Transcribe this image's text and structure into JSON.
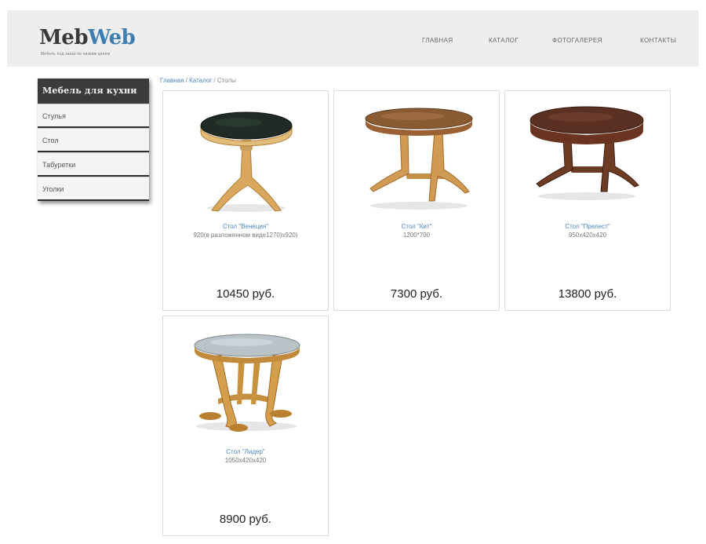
{
  "header": {
    "logo_part1": "Meb",
    "logo_part2": "Web",
    "tagline": "Мебель под заказ по низким ценам",
    "nav": [
      "ГЛАВНАЯ",
      "КАТАЛОГ",
      "ФОТОГАЛЕРЕЯ",
      "КОНТАКТЫ"
    ]
  },
  "sidebar": {
    "title": "Мебель для кухни",
    "items": [
      "Стулья",
      "Стол",
      "Табуретки",
      "Уголки"
    ]
  },
  "breadcrumb": {
    "home": "Главная",
    "sep1": " / ",
    "catalog": "Каталог",
    "sep2": " / ",
    "current": "Столы"
  },
  "products": [
    {
      "name": "Стол \"Венеция\"",
      "desc": "920(в разложенном виде1270)х920)",
      "price": "10450 руб.",
      "icon": "round-table-icon",
      "top_color": "#1f2b24"
    },
    {
      "name": "Стол \"Кит\"",
      "desc": "1200*700",
      "price": "7300 руб.",
      "icon": "oval-table-icon",
      "top_color": "#8a5a32"
    },
    {
      "name": "Стол \"Прелест\"",
      "desc": "950x420x420",
      "price": "13800 руб.",
      "icon": "dark-oval-table-icon",
      "top_color": "#5a3022"
    },
    {
      "name": "Стол \"Лидер\"",
      "desc": "1050x420x420",
      "price": "8900 руб.",
      "icon": "grey-top-table-icon",
      "top_color": "#b9c3c8"
    }
  ],
  "colors": {
    "accent": "#3e7fb3",
    "sidebar_dark": "#3b3b3b",
    "header_bg": "#eeeeee",
    "wood": "#d9a85e"
  }
}
